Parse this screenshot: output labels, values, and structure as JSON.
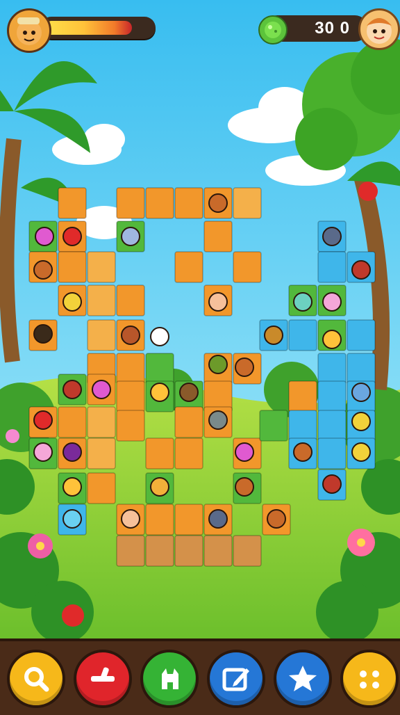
{
  "hud": {
    "score_text": "30 0",
    "health_fraction": 0.82,
    "player_avatar_icon": "hero-face-icon",
    "currency_icon": "green-gem-icon",
    "opponent_avatar_icon": "boy-face-icon"
  },
  "toolbar": {
    "buttons": [
      {
        "name": "search-button",
        "icon": "magnifier-icon",
        "color": "#f6b81a"
      },
      {
        "name": "remove-button",
        "icon": "cross-minus-icon",
        "color": "#e0252b"
      },
      {
        "name": "character-button",
        "icon": "creature-icon",
        "color": "#35b335"
      },
      {
        "name": "edit-button",
        "icon": "pencil-box-icon",
        "color": "#2577d6"
      },
      {
        "name": "favorite-button",
        "icon": "star-icon",
        "color": "#2577d6"
      },
      {
        "name": "menu-button",
        "icon": "dots-face-icon",
        "color": "#f6b81a"
      }
    ]
  },
  "board": {
    "colors": {
      "orange": "#f2972b",
      "light": "#f4b04a",
      "green": "#52b83c",
      "blue": "#3fb6ea",
      "dirt": "#d4914a"
    }
  }
}
